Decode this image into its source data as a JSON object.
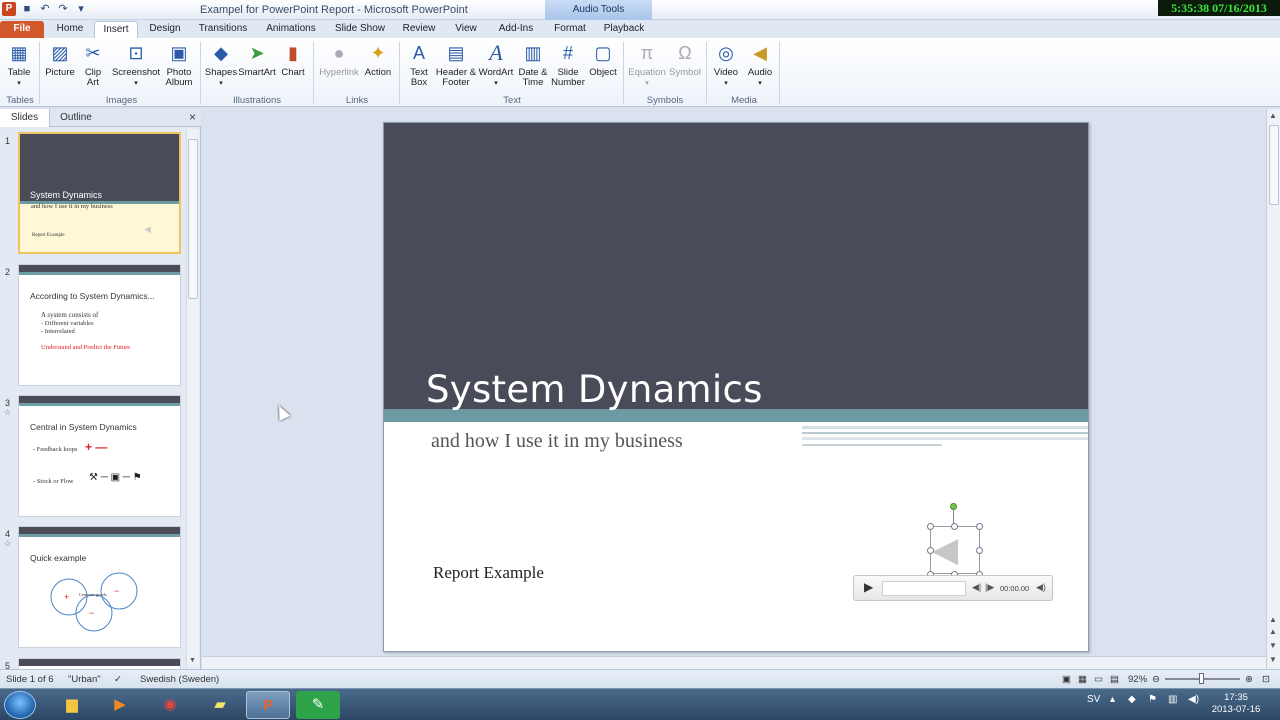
{
  "window": {
    "title": "Exampel for PowerPoint Report - Microsoft PowerPoint",
    "contextual_group": "Audio Tools",
    "overlay_clock": "5:35:38  07/16/2013",
    "app_icon_letter": "P"
  },
  "tabs": [
    {
      "label": "File"
    },
    {
      "label": "Home"
    },
    {
      "label": "Insert"
    },
    {
      "label": "Design"
    },
    {
      "label": "Transitions"
    },
    {
      "label": "Animations"
    },
    {
      "label": "Slide Show"
    },
    {
      "label": "Review"
    },
    {
      "label": "View"
    },
    {
      "label": "Add-Ins"
    },
    {
      "label": "Format"
    },
    {
      "label": "Playback"
    }
  ],
  "ribbon": {
    "buttons": [
      {
        "label": "Table",
        "icon": "table-icon"
      },
      {
        "label": "Picture",
        "icon": "picture-icon"
      },
      {
        "label": "Clip Art",
        "icon": "clipart-icon"
      },
      {
        "label": "Screenshot",
        "icon": "screenshot-icon"
      },
      {
        "label": "Photo Album",
        "icon": "photo-album-icon"
      },
      {
        "label": "Shapes",
        "icon": "shapes-icon"
      },
      {
        "label": "SmartArt",
        "icon": "smartart-icon"
      },
      {
        "label": "Chart",
        "icon": "chart-icon"
      },
      {
        "label": "Hyperlink",
        "icon": "hyperlink-icon",
        "disabled": true
      },
      {
        "label": "Action",
        "icon": "action-icon"
      },
      {
        "label": "Text Box",
        "icon": "textbox-icon"
      },
      {
        "label": "Header & Footer",
        "icon": "header-footer-icon"
      },
      {
        "label": "WordArt",
        "icon": "wordart-icon"
      },
      {
        "label": "Date & Time",
        "icon": "date-time-icon"
      },
      {
        "label": "Slide Number",
        "icon": "slide-number-icon"
      },
      {
        "label": "Object",
        "icon": "object-icon"
      },
      {
        "label": "Equation",
        "icon": "equation-icon",
        "disabled": true
      },
      {
        "label": "Symbol",
        "icon": "symbol-icon",
        "disabled": true
      },
      {
        "label": "Video",
        "icon": "video-icon"
      },
      {
        "label": "Audio",
        "icon": "audio-icon"
      }
    ],
    "groups": [
      {
        "label": "Tables"
      },
      {
        "label": "Images"
      },
      {
        "label": "Illustrations"
      },
      {
        "label": "Links"
      },
      {
        "label": "Text"
      },
      {
        "label": "Symbols"
      },
      {
        "label": "Media"
      }
    ]
  },
  "left_pane": {
    "tabs": [
      {
        "label": "Slides"
      },
      {
        "label": "Outline"
      }
    ],
    "close": "×",
    "thumbnails": [
      {
        "num": "1",
        "title": "System Dynamics",
        "subtitle": "and how I use it in my business",
        "footer": "Report Example"
      },
      {
        "num": "2",
        "title": "According to System Dynamics...",
        "lines": [
          "A system consists of",
          "- Different variables",
          "- Interrelated"
        ],
        "red": "Understand and Predict the Future"
      },
      {
        "num": "3",
        "title": "Central in System Dynamics",
        "lines": [
          "- Feedback loops",
          "- Stock or Flow"
        ]
      },
      {
        "num": "4",
        "title": "Quick example",
        "lines": [
          "Centrum goods"
        ]
      },
      {
        "num": "5"
      }
    ]
  },
  "slide": {
    "title": "System Dynamics",
    "subtitle": "and how I use it in my business",
    "footer_text": "Report Example",
    "audio_time": "00:00.00",
    "colors": {
      "dark": "#4a4b58",
      "teal": "#6d9aa2"
    }
  },
  "status": {
    "slide_of": "Slide 1 of 6",
    "theme": "\"Urban\"",
    "language": "Swedish (Sweden)",
    "zoom": "92%"
  },
  "taskbar": {
    "lang": "SV",
    "time": "17:35",
    "date": "2013-07-16"
  }
}
